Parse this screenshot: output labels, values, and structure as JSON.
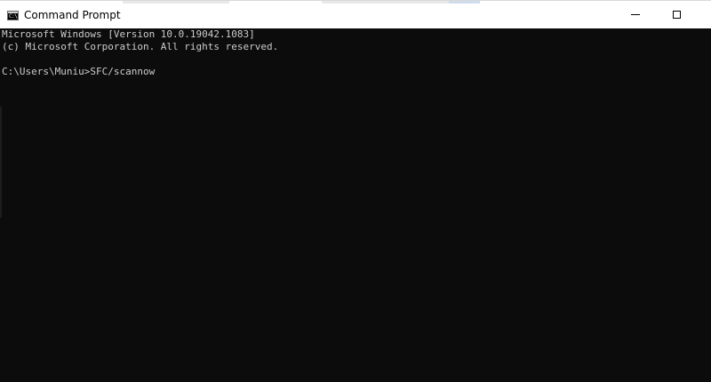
{
  "window": {
    "title": "Command Prompt",
    "icon": "cmd-icon",
    "icon_glyph": "C:\\",
    "buttons": {
      "minimize": "minimize-icon",
      "maximize": "maximize-icon",
      "close": "close-icon"
    }
  },
  "console": {
    "lines": [
      "Microsoft Windows [Version 10.0.19042.1083]",
      "(c) Microsoft Corporation. All rights reserved.",
      "",
      "C:\\Users\\Muniu>SFC/scannow"
    ],
    "background": "#0c0c0c",
    "foreground": "#cccccc"
  }
}
